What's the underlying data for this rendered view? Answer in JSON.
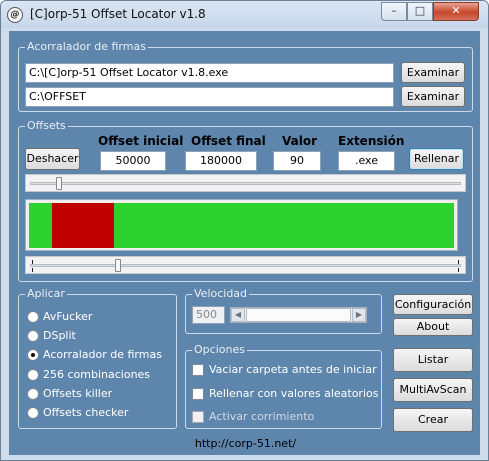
{
  "window": {
    "icon_letter": "@",
    "title": "[C]orp-51 Offset Locator v1.8",
    "minimize_glyph": "–",
    "maximize_glyph": "□",
    "close_glyph": "✕"
  },
  "acorralador": {
    "label": "Acorralador de firmas",
    "file_path": "C:\\[C]orp-51 Offset Locator v1.8.exe",
    "output_path": "C:\\OFFSET",
    "browse1_label": "Examinar",
    "browse2_label": "Examinar"
  },
  "offsets": {
    "label": "Offsets",
    "undo_label": "Deshacer",
    "fill_label": "Rellenar",
    "headers": {
      "start": "Offset inicial",
      "end": "Offset final",
      "value": "Valor",
      "extension": "Extensión"
    },
    "start_value": "50000",
    "end_value": "180000",
    "fill_value": "90",
    "extension_value": ".exe",
    "range_bar": {
      "start_fraction": 0.054,
      "end_fraction": 0.2,
      "fill_color": "#2ed22e",
      "range_color": "#c00000"
    },
    "top_slider_fraction": 0.06,
    "bottom_slider_fraction": 0.2
  },
  "aplicar": {
    "label": "Aplicar",
    "options": [
      {
        "label": "AvFucker",
        "selected": false
      },
      {
        "label": "DSplit",
        "selected": false
      },
      {
        "label": "Acorralador de firmas",
        "selected": true
      },
      {
        "label": "256 combinaciones",
        "selected": false
      },
      {
        "label": "Offsets killer",
        "selected": false
      },
      {
        "label": "Offsets checker",
        "selected": false
      }
    ]
  },
  "velocidad": {
    "label": "Velocidad",
    "value": "500",
    "left_arrow": "◀",
    "right_arrow": "▶"
  },
  "opciones": {
    "label": "Opciones",
    "items": [
      {
        "label": "Vaciar carpeta antes de iniciar",
        "checked": false,
        "enabled": true
      },
      {
        "label": "Rellenar con valores aleatorios",
        "checked": false,
        "enabled": true
      },
      {
        "label": "Activar corrimiento",
        "checked": false,
        "enabled": false
      }
    ]
  },
  "buttons": {
    "config": "Configuración",
    "about": "About",
    "listar": "Listar",
    "multiav": "MultiAvScan",
    "crear": "Crear"
  },
  "footer": {
    "url": "http://corp-51.net/"
  }
}
